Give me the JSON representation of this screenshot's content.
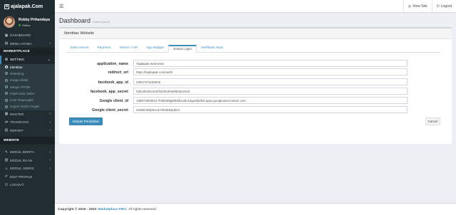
{
  "app": {
    "logo_text": "ajalapak.Com",
    "logo_mark": "B"
  },
  "header": {
    "menu_icon": "hamburger-icon",
    "view_site": "View Site",
    "logout": "Logout"
  },
  "user": {
    "name": "Robby Prihandaya",
    "status": "Online"
  },
  "sidebar": {
    "dashboard": "DASHBOARD",
    "menu_utama": "MENU UTAMA",
    "marketplace_header": "MARKETPLACE",
    "setting": "SETTING",
    "sub": [
      "Identitas",
      "Rekening",
      "Image Slider",
      "Margin PPOB",
      "Paket Star Seller",
      "Kurir Rajaongkir",
      "Kupon Gratis Ongkir"
    ],
    "master": "MASTER",
    "transaksi": "TRANSAKSI",
    "report": "REPORT",
    "website_header": "WEBSITE",
    "modul_berita": "MODUL BERITA",
    "modul_iklan": "MODUL IKLAN",
    "modul_users": "MODUL USERS",
    "edit_profile": "EDIT PROFILE",
    "logout": "LOGOUT"
  },
  "page": {
    "title": "Dashboard",
    "subtitle": "Control panel"
  },
  "box": {
    "title": "Identitas Website"
  },
  "tabs": [
    "Data Umum",
    "Payment",
    "Server / API",
    "App Widget",
    "Sosial Login",
    "Verifikasi Akun"
  ],
  "form": {
    "rows": [
      {
        "label": "application_name",
        "value": "Tajalapak Indonesia"
      },
      {
        "label": "redirect_url",
        "value": "https://tajalapak.com/auth/"
      },
      {
        "label": "facebook_app_id",
        "value": "23947474163615"
      },
      {
        "label": "facebook_app_secret",
        "value": "02b10b44ec634f1b2fed3e66be61e515"
      },
      {
        "label": "Google client_id",
        "value": "1085746h0613-7h0fpd8lgdt5ddl1sdlo1dgo6ljn0bd.apps.googleusercontent.com"
      },
      {
        "label": "Google client_secret",
        "value": "2W6dcWQ9e1Je7iENK8JpdG2"
      }
    ],
    "save_button": "Simpan Perubahan",
    "cancel_button": "Cancel"
  },
  "footer": {
    "copyright": "Copyright © 2016 - 2022",
    "brand": "Marketplace PRO.",
    "rights": "All rights reserved."
  }
}
